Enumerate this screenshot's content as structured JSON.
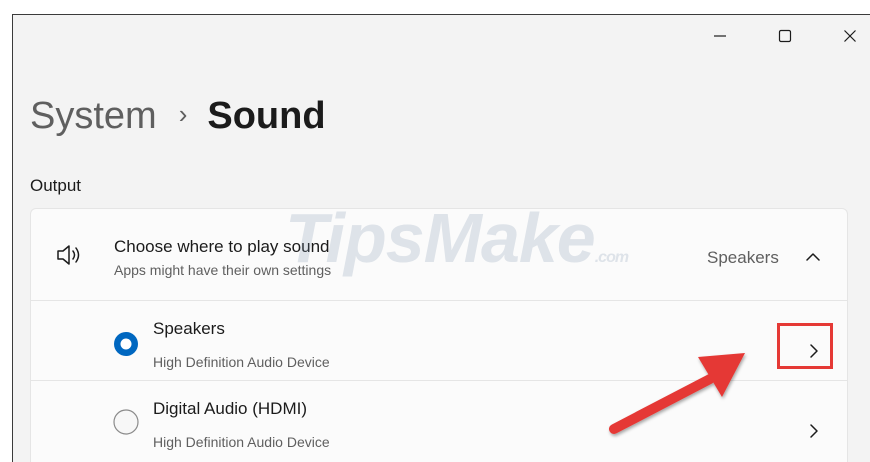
{
  "window": {
    "controls": {
      "minimize_icon": "minimize-icon",
      "maximize_icon": "maximize-icon",
      "close_icon": "close-icon"
    }
  },
  "breadcrumb": {
    "parent": "System",
    "separator": "›",
    "current": "Sound"
  },
  "output": {
    "section_label": "Output",
    "header": {
      "icon": "speaker-volume-icon",
      "title": "Choose where to play sound",
      "subtitle": "Apps might have their own settings",
      "selected_value": "Speakers",
      "expanded": true
    },
    "devices": [
      {
        "name": "Speakers",
        "description": "High Definition Audio Device",
        "selected": true
      },
      {
        "name": "Digital Audio (HDMI)",
        "description": "High Definition Audio Device",
        "selected": false
      }
    ]
  },
  "annotations": {
    "watermark_main": "TipsMake",
    "watermark_suffix": ".com",
    "highlight_color": "#e53935",
    "arrow_color": "#e53935"
  },
  "colors": {
    "accent": "#0067c0",
    "window_bg": "#f3f3f3",
    "card_bg": "#fbfbfb"
  }
}
